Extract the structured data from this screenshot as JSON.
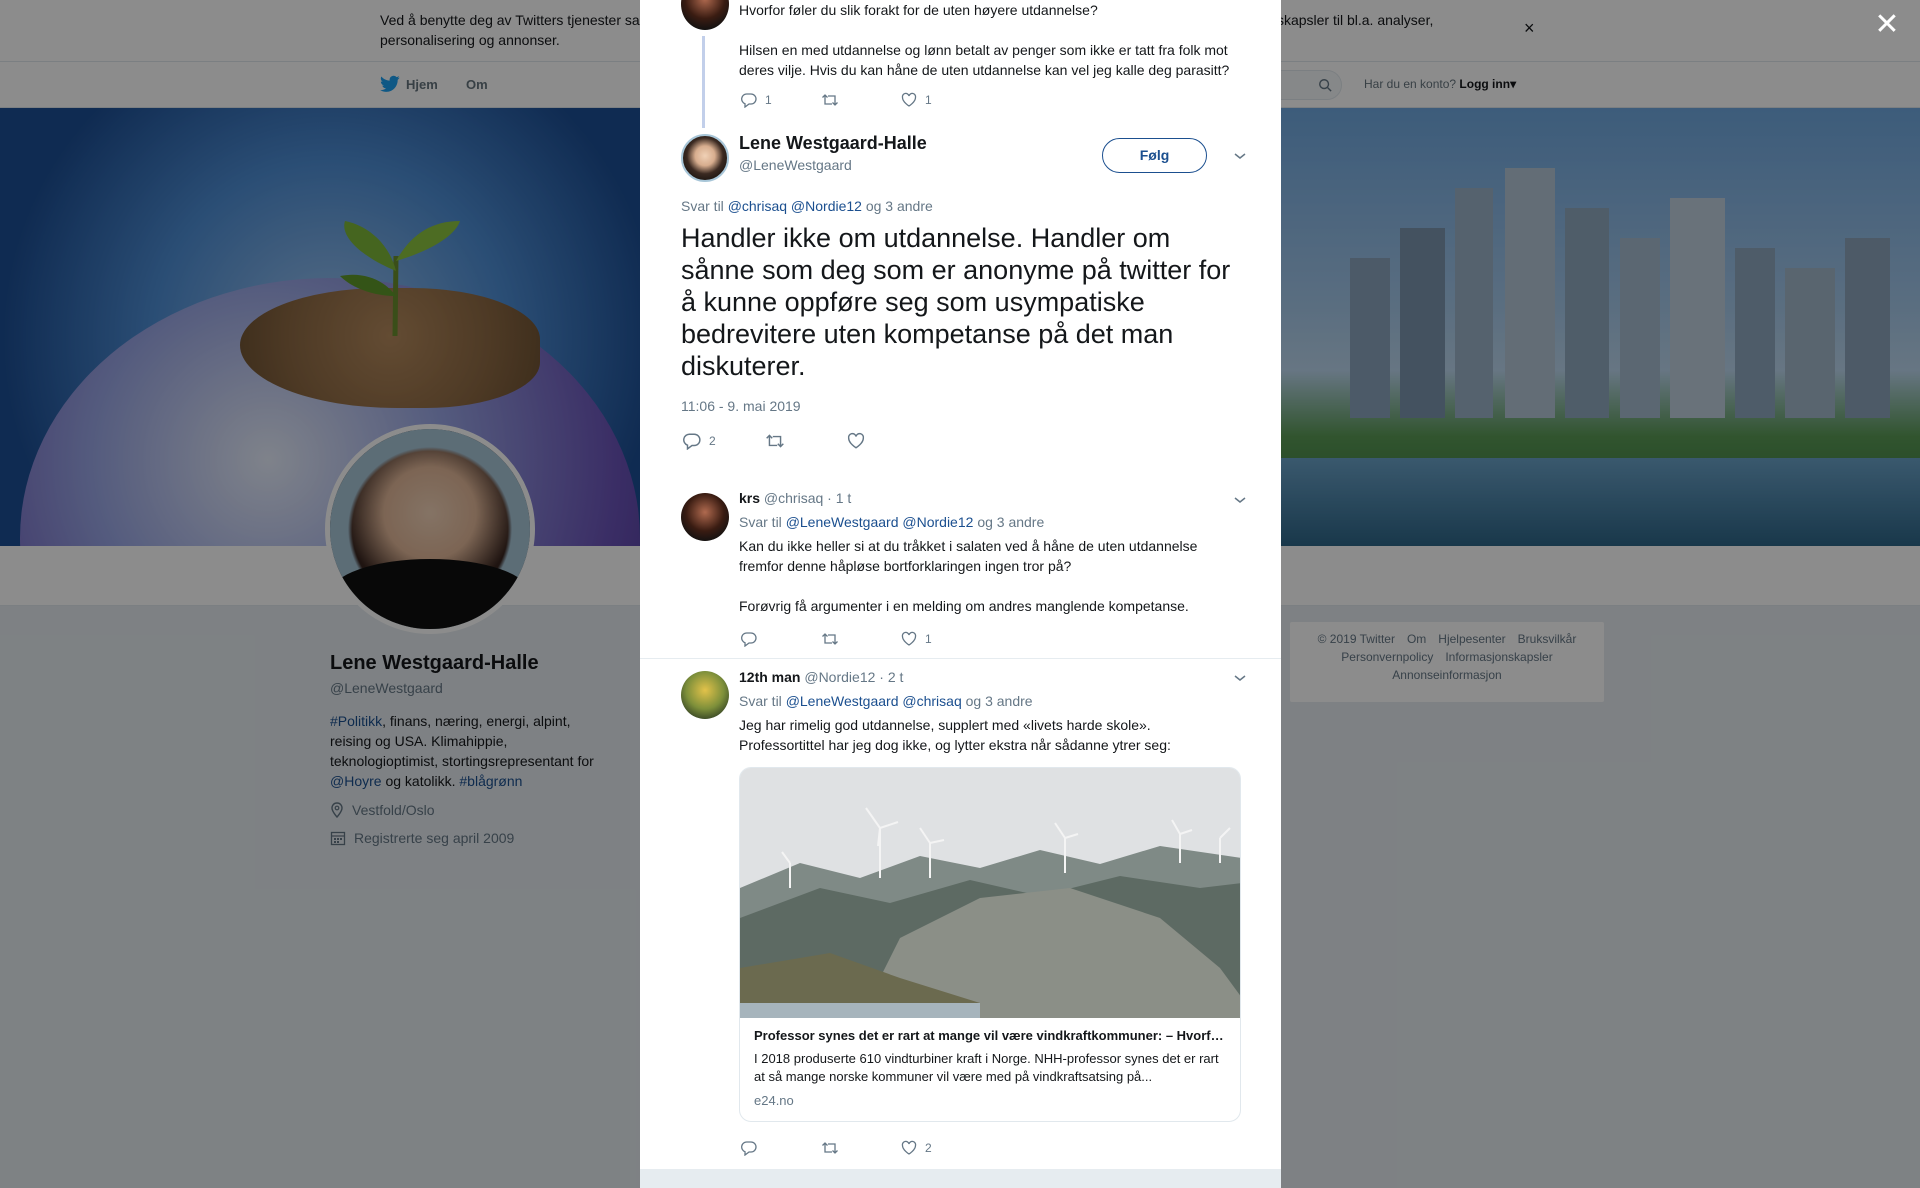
{
  "cookie_bar": {
    "text": "Ved å benytte deg av Twitters tjenester samtykker du til vår bruk av informasjonskapsler og til at data samles inn og brukes, inkludert informasjonskapsler til bl.a. analyser, personalisering og annonser."
  },
  "nav": {
    "home": "Hjem",
    "about": "Om",
    "login_prompt": "Har du en konto?",
    "login": "Logg inn"
  },
  "profile": {
    "name": "Lene Westgaard-Halle",
    "handle": "@LeneWestgaard",
    "bio_link1": "#Politikk",
    "bio_text1": ", finans, næring, energi, alpint, reising og USA. Klimahippie, teknologioptimist, stortingsrepresentant for ",
    "bio_link2": "@Hoyre",
    "bio_text2": " og katolikk. ",
    "bio_link3": "#blågrønn",
    "location": "Vestfold/Oslo",
    "joined": "Registrerte seg april 2009"
  },
  "footer": {
    "items": [
      "© 2019 Twitter",
      "Om",
      "Hjelpesenter",
      "Bruksvilkår",
      "Personvernpolicy",
      "Informasjonskapsler",
      "Annonseinformasjon"
    ]
  },
  "modal": {
    "prev_tweet": {
      "line1": "Hvorfor føler du slik forakt for de uten høyere utdannelse?",
      "line2": "Hilsen en med utdannelse og lønn betalt av penger som ikke er tatt fra folk mot deres vilje. Hvis du kan håne de uten utdannelse kan vel jeg kalle deg parasitt?",
      "replies": "1",
      "likes": "1"
    },
    "main_tweet": {
      "name": "Lene Westgaard-Halle",
      "handle": "@LeneWestgaard",
      "follow": "Følg",
      "reply_label": "Svar til",
      "reply_user1": "@chrisaq",
      "reply_user2": "@Nordie12",
      "reply_others": "og 3 andre",
      "text": "Handler ikke om utdannelse. Handler om sånne som deg som er anonyme på twitter for å kunne oppføre seg som usympatiske bedrevitere uten kompetanse på det man diskuterer.",
      "time": "11:06 - 9. mai 2019",
      "replies": "2"
    },
    "reply1": {
      "name": "krs",
      "handle": "@chrisaq",
      "age": "· 1 t",
      "reply_label": "Svar til",
      "reply_user1": "@LeneWestgaard",
      "reply_user2": "@Nordie12",
      "reply_others": "og 3 andre",
      "text1": "Kan du ikke heller si at du tråkket i salaten ved å håne de uten utdannelse fremfor denne håpløse bortforklaringen ingen tror på?",
      "text2": "Forøvrig få argumenter i en melding om andres manglende kompetanse.",
      "likes": "1"
    },
    "reply2": {
      "name": "12th man",
      "handle": "@Nordie12",
      "age": "· 2 t",
      "reply_label": "Svar til",
      "reply_user1": "@LeneWestgaard",
      "reply_user2": "@chrisaq",
      "reply_others": "og 3 andre",
      "text": "Jeg har rimelig god utdannelse, supplert med «livets harde skole». Professortittel har jeg dog ikke, og lytter ekstra når sådanne ytrer seg:",
      "card_title": "Professor synes det er rart at mange vil være vindkraftkommuner: – Hvorfor?",
      "card_desc": "I 2018 produserte 610 vindturbiner kraft i Norge. NHH-professor synes det er rart at så mange norske kommuner vil være med på vindkraftsatsing på...",
      "card_domain": "e24.no",
      "likes": "2"
    }
  },
  "colors": {
    "link": "#1b4f8f",
    "muted": "#657786"
  }
}
